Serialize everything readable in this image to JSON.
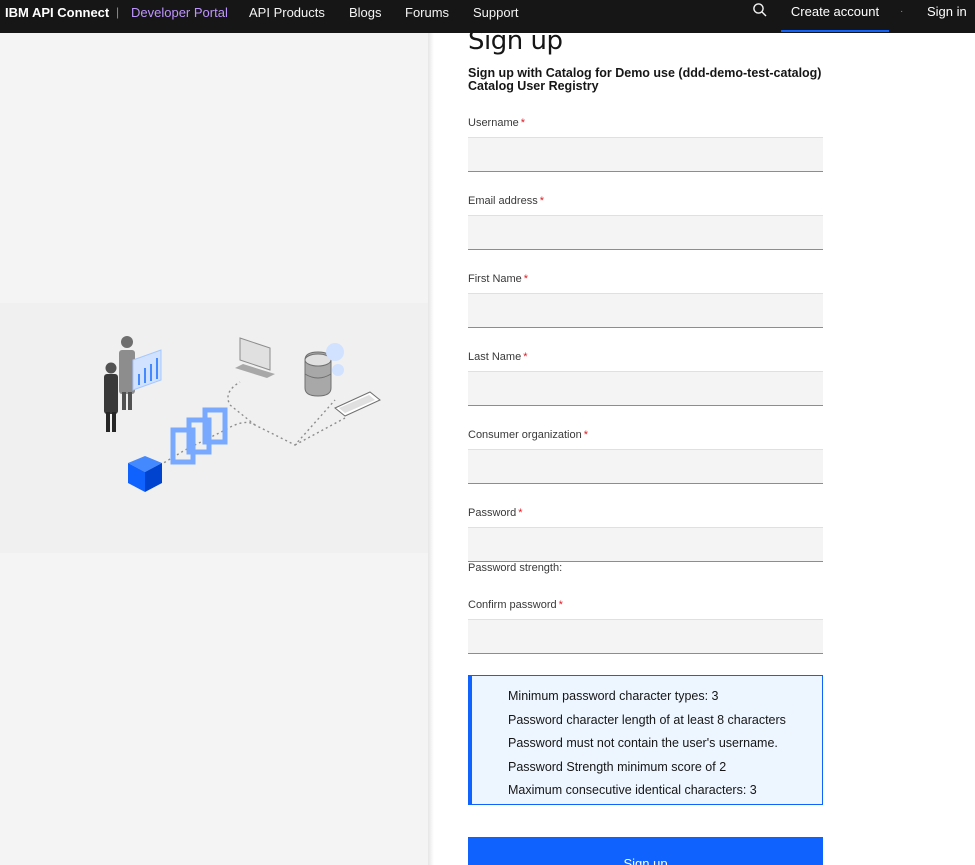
{
  "nav": {
    "brand": "IBM API Connect",
    "separator": "|",
    "links": [
      {
        "label": "Developer Portal",
        "active": true
      },
      {
        "label": "API Products",
        "active": false
      },
      {
        "label": "Blogs",
        "active": false
      },
      {
        "label": "Forums",
        "active": false
      },
      {
        "label": "Support",
        "active": false
      }
    ],
    "search_icon": "search-icon",
    "create_account": "Create account",
    "dot": "·",
    "sign_in": "Sign in"
  },
  "form": {
    "title": "Sign up",
    "subtitle": "Sign up with Catalog for Demo use (ddd-demo-test-catalog) Catalog User Registry",
    "required_marker": "*",
    "fields": [
      {
        "label": "Username",
        "value": ""
      },
      {
        "label": "Email address",
        "value": ""
      },
      {
        "label": "First Name",
        "value": ""
      },
      {
        "label": "Last Name",
        "value": ""
      },
      {
        "label": "Consumer organization",
        "value": ""
      },
      {
        "label": "Password",
        "value": ""
      },
      {
        "label": "Confirm password",
        "value": ""
      }
    ],
    "password_strength_label": "Password strength:",
    "rules": [
      "Minimum password character types: 3",
      "Password character length of at least 8 characters",
      "Password must not contain the user's username.",
      "Password Strength minimum score of 2",
      "Maximum consecutive identical characters: 3"
    ],
    "submit_label": "Sign up"
  },
  "colors": {
    "nav_bg": "#161616",
    "active_link": "#be95ff",
    "accent": "#0f62fe",
    "required": "#da1e28",
    "rules_bg": "#edf5ff"
  }
}
